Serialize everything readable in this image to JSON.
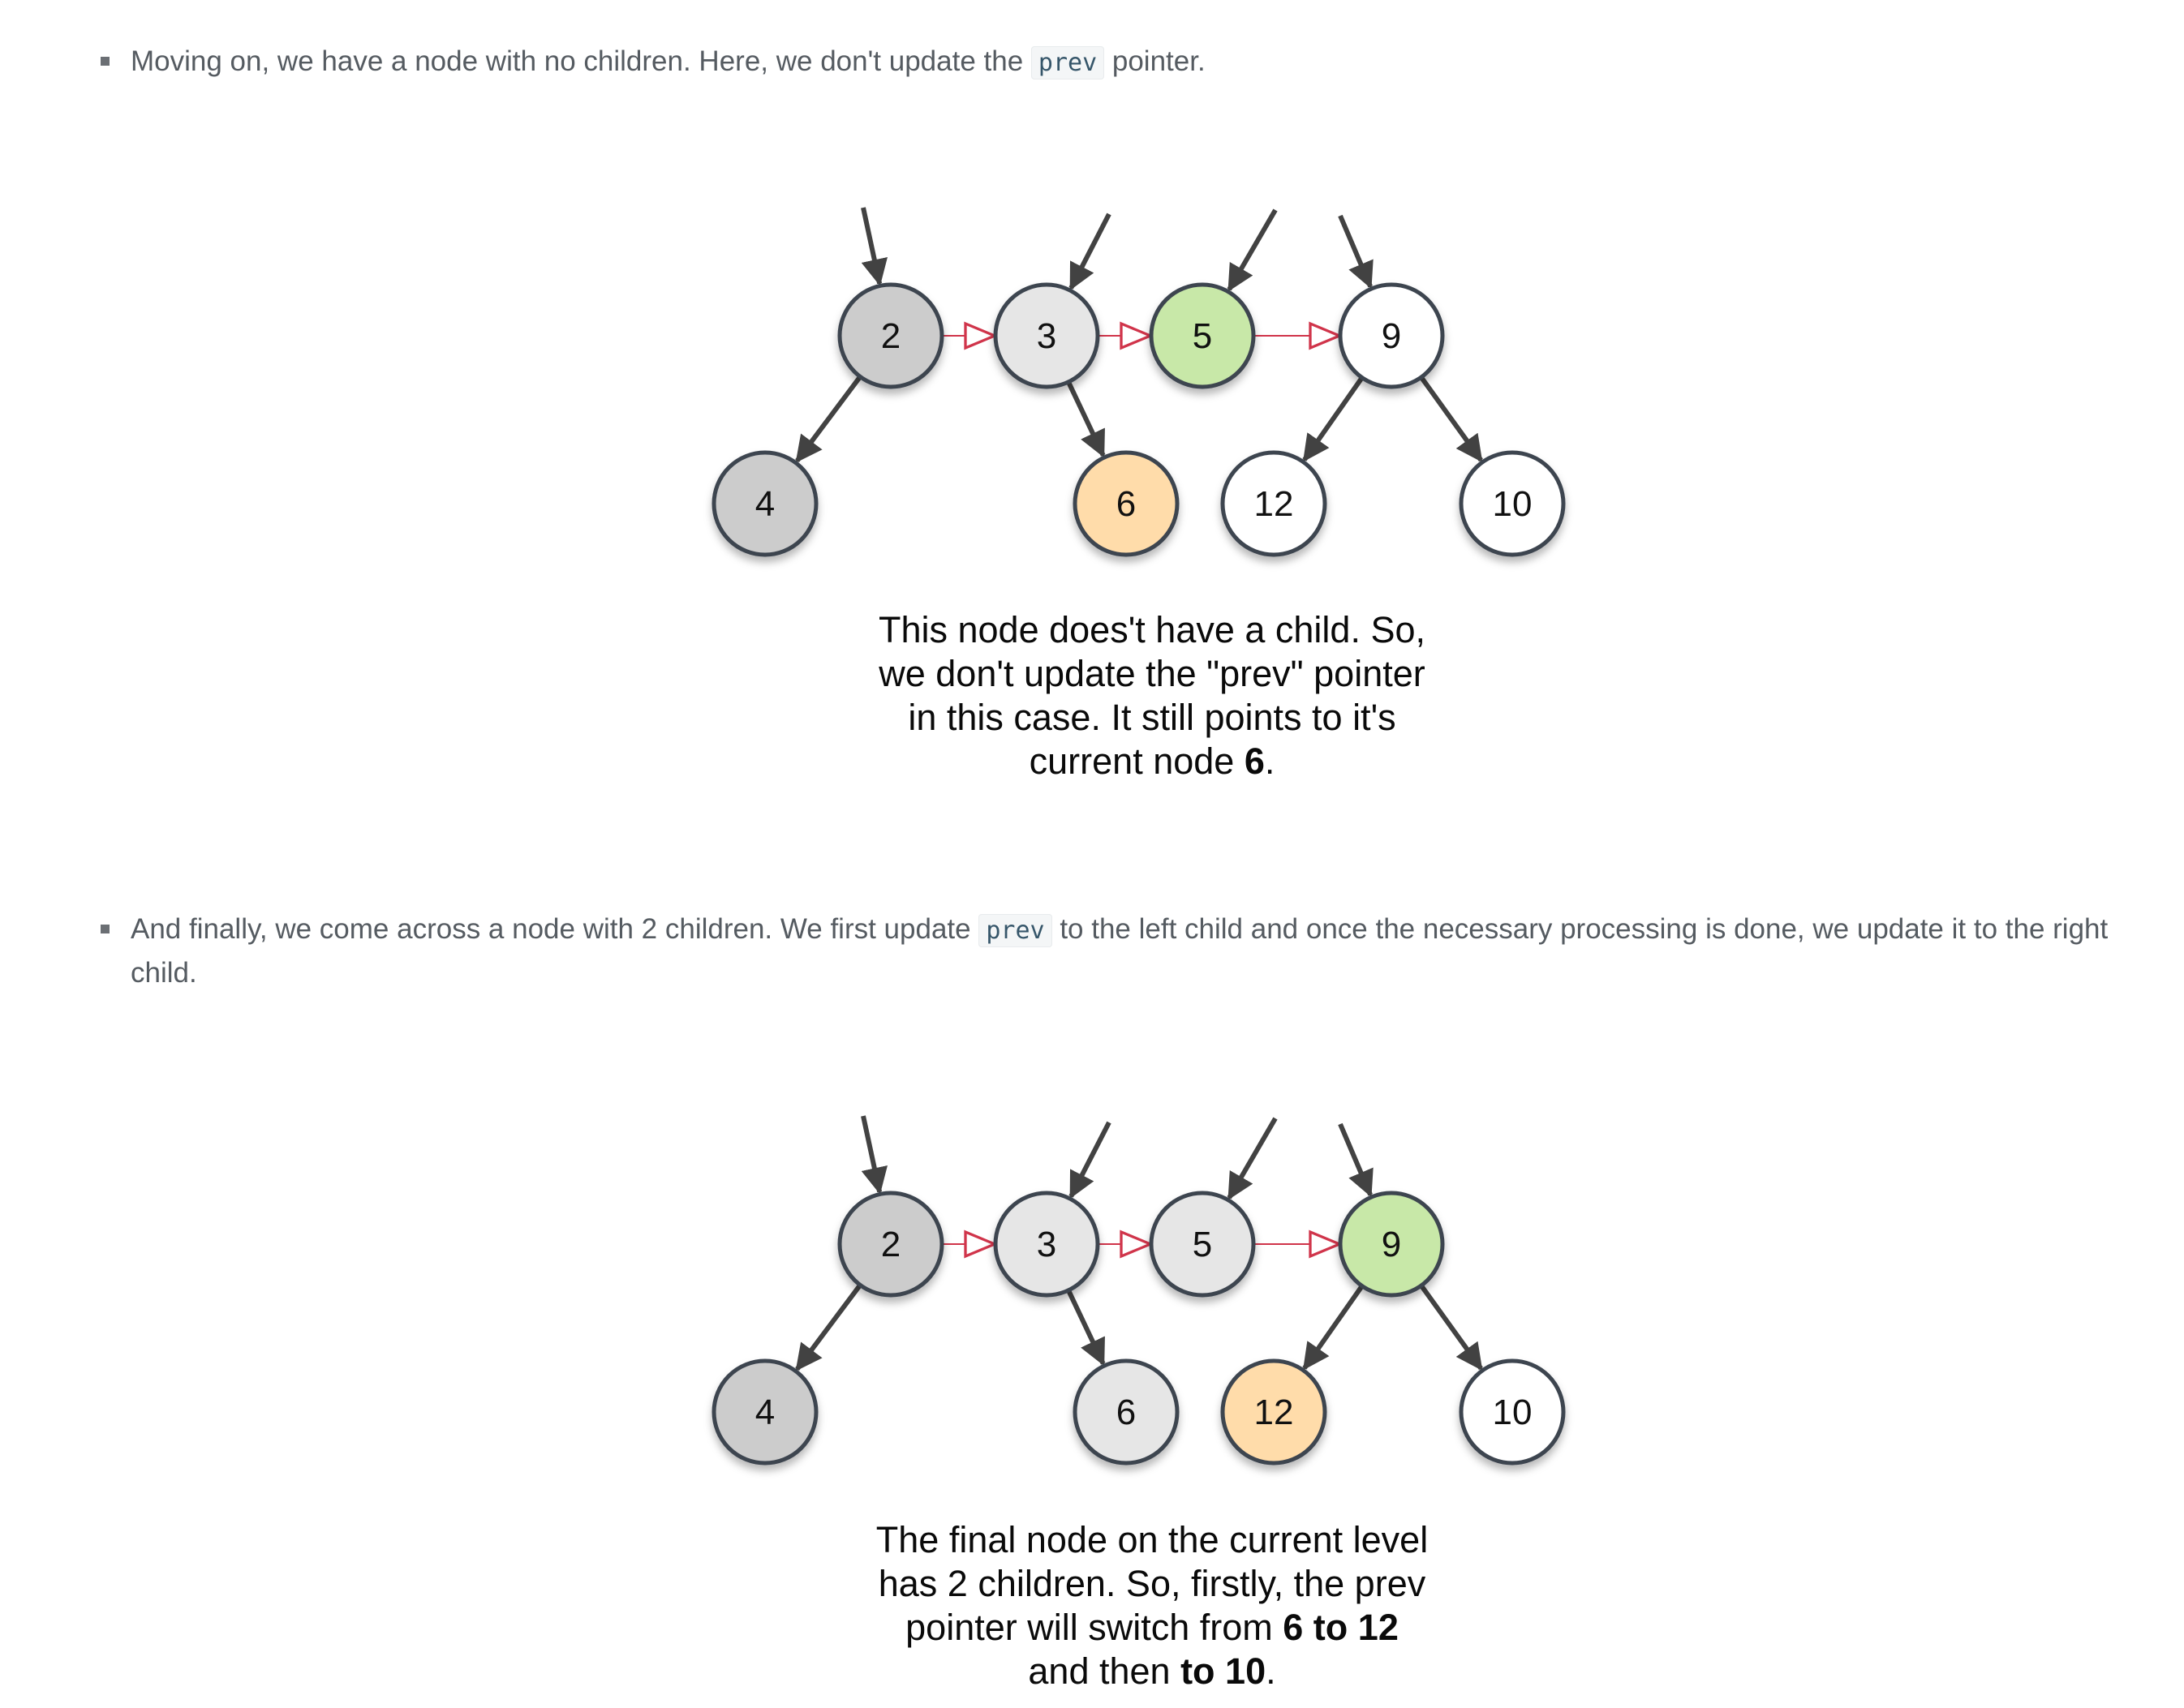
{
  "bullets": [
    {
      "before": "Moving on, we have a node with no children. Here, we don't update the ",
      "code": "prev",
      "after": " pointer."
    },
    {
      "before": "And finally, we come across a node with 2 children. We first update ",
      "code": "prev",
      "after": " to the left child and once the necessary processing is done, we update it to the right child."
    }
  ],
  "diagrams": [
    {
      "nodes": [
        {
          "id": "2",
          "label": "2",
          "fill": "#cccccc"
        },
        {
          "id": "3",
          "label": "3",
          "fill": "#e6e6e6"
        },
        {
          "id": "5",
          "label": "5",
          "fill": "#c8e8a8"
        },
        {
          "id": "9",
          "label": "9",
          "fill": "#ffffff"
        },
        {
          "id": "4",
          "label": "4",
          "fill": "#cccccc"
        },
        {
          "id": "6",
          "label": "6",
          "fill": "#ffdcaa"
        },
        {
          "id": "12",
          "label": "12",
          "fill": "#ffffff"
        },
        {
          "id": "10",
          "label": "10",
          "fill": "#ffffff"
        }
      ],
      "next_links": [
        [
          "2",
          "3"
        ],
        [
          "3",
          "5"
        ],
        [
          "5",
          "9"
        ]
      ],
      "child_edges": [
        [
          "2",
          "4"
        ],
        [
          "3",
          "6"
        ],
        [
          "9",
          "12"
        ],
        [
          "9",
          "10"
        ]
      ],
      "incoming_pointers": [
        "2",
        "3",
        "5",
        "9"
      ],
      "caption": {
        "line1": "This node does't have a child. So,",
        "line2": "we don't update the \"prev\" pointer",
        "line3": "in this case. It still points to it's",
        "line4_before": "current node ",
        "line4_bold": "6",
        "line4_after": "."
      }
    },
    {
      "nodes": [
        {
          "id": "2",
          "label": "2",
          "fill": "#cccccc"
        },
        {
          "id": "3",
          "label": "3",
          "fill": "#e6e6e6"
        },
        {
          "id": "5",
          "label": "5",
          "fill": "#e6e6e6"
        },
        {
          "id": "9",
          "label": "9",
          "fill": "#c8e8a8"
        },
        {
          "id": "4",
          "label": "4",
          "fill": "#cccccc"
        },
        {
          "id": "6",
          "label": "6",
          "fill": "#e6e6e6"
        },
        {
          "id": "12",
          "label": "12",
          "fill": "#ffdcaa"
        },
        {
          "id": "10",
          "label": "10",
          "fill": "#ffffff"
        }
      ],
      "next_links": [
        [
          "2",
          "3"
        ],
        [
          "3",
          "5"
        ],
        [
          "5",
          "9"
        ]
      ],
      "child_edges": [
        [
          "2",
          "4"
        ],
        [
          "3",
          "6"
        ],
        [
          "9",
          "12"
        ],
        [
          "9",
          "10"
        ]
      ],
      "incoming_pointers": [
        "2",
        "3",
        "5",
        "9"
      ],
      "caption": {
        "line1": "The final node on the current level",
        "line2": "has 2 children. So, firstly, the prev",
        "line3_before": "pointer will switch from ",
        "line3_bold": "6 to 12",
        "line4_before": "and then ",
        "line4_bold": "to 10",
        "line4_after": "."
      }
    }
  ],
  "colors": {
    "node_stroke": "#3d4450",
    "edge": "#424242",
    "next_link": "#d0344a",
    "caption_text": "#0a0a0a",
    "body_text": "#555b61"
  }
}
